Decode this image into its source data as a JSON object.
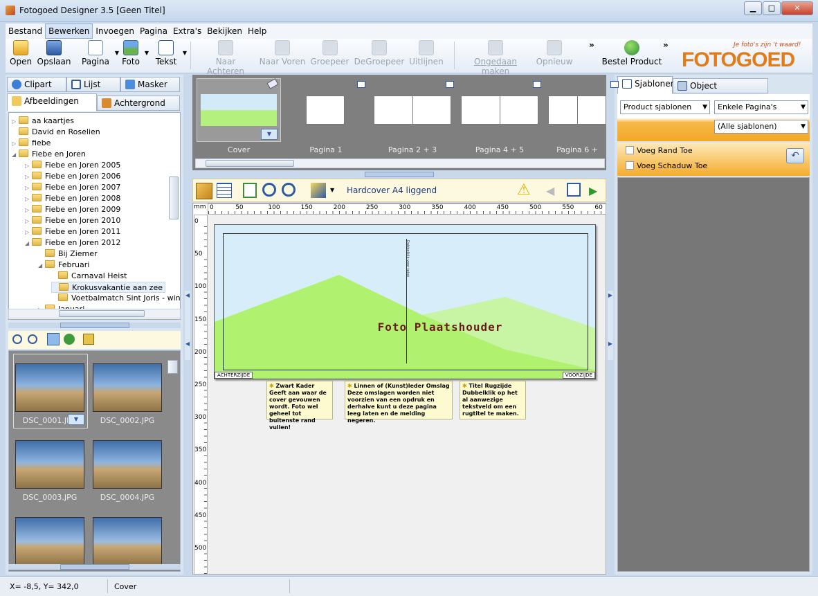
{
  "window": {
    "title": "Fotogoed Designer 3.5 [Geen Titel]",
    "min": "▁",
    "max": "□",
    "close": "✕"
  },
  "menu": [
    "Bestand",
    "Bewerken",
    "Invoegen",
    "Pagina",
    "Extra's",
    "Bekijken",
    "Help"
  ],
  "toolbar": {
    "open": "Open",
    "save": "Opslaan",
    "page": "Pagina",
    "photo": "Foto",
    "text": "Tekst",
    "send_back": "Naar Achteren",
    "bring_front": "Naar Voren",
    "group": "Groepeer",
    "ungroup": "DeGroepeer",
    "align": "Uitlijnen",
    "undo": "Ongedaan maken",
    "redo": "Opnieuw",
    "order": "Bestel Product",
    "overflow": "»"
  },
  "logo": {
    "text": "FOTOGOED",
    "slogan": "Je foto's zijn 't waard!",
    "color": "#e37b18"
  },
  "left_tabs": {
    "clipart": "Clipart",
    "list": "Lijst",
    "mask": "Masker",
    "images": "Afbeeldingen",
    "background": "Achtergrond"
  },
  "tree": [
    {
      "label": "aa kaartjes",
      "level": 0,
      "exp": "▷"
    },
    {
      "label": "David en Roselien",
      "level": 0,
      "exp": ""
    },
    {
      "label": "fiebe",
      "level": 0,
      "exp": "▷"
    },
    {
      "label": "Fiebe en Joren",
      "level": 0,
      "exp": "◢"
    },
    {
      "label": "Fiebe en Joren 2005",
      "level": 1,
      "exp": "▷"
    },
    {
      "label": "Fiebe en Joren 2006",
      "level": 1,
      "exp": "▷"
    },
    {
      "label": "Fiebe en Joren 2007",
      "level": 1,
      "exp": "▷"
    },
    {
      "label": "Fiebe en Joren 2008",
      "level": 1,
      "exp": "▷"
    },
    {
      "label": "Fiebe en Joren 2009",
      "level": 1,
      "exp": "▷"
    },
    {
      "label": "Fiebe en Joren 2010",
      "level": 1,
      "exp": "▷"
    },
    {
      "label": "Fiebe en Joren 2011",
      "level": 1,
      "exp": "▷"
    },
    {
      "label": "Fiebe en Joren 2012",
      "level": 1,
      "exp": "◢"
    },
    {
      "label": "Bij Ziemer",
      "level": 2,
      "exp": ""
    },
    {
      "label": "Februari",
      "level": 2,
      "exp": "◢"
    },
    {
      "label": "Carnaval Heist",
      "level": 3,
      "exp": ""
    },
    {
      "label": "Krokusvakantie aan zee",
      "level": 3,
      "exp": "",
      "selected": true
    },
    {
      "label": "Voetbalmatch Sint Joris - win",
      "level": 3,
      "exp": ""
    },
    {
      "label": "Januari",
      "level": 2,
      "exp": "▷"
    }
  ],
  "thumbnails": [
    "DSC_0001.JPG",
    "DSC_0002.JPG",
    "DSC_0003.JPG",
    "DSC_0004.JPG",
    "",
    ""
  ],
  "pages": [
    "Cover",
    "Pagina 1",
    "Pagina 2 + 3",
    "Pagina 4 + 5",
    "Pagina 6 +"
  ],
  "editor": {
    "product_label": "Hardcover A4 liggend",
    "ruler_unit": "mm",
    "hticks": [
      "0",
      "50",
      "100",
      "150",
      "200",
      "250",
      "300",
      "350",
      "400",
      "450",
      "500",
      "550",
      "60"
    ],
    "vticks": [
      "0",
      "50",
      "100",
      "150",
      "200",
      "250",
      "300",
      "350",
      "400",
      "450",
      "500"
    ],
    "placeholder": "Foto Plaatshouder",
    "back": "ACHTERZIJDE",
    "front": "VOORZIJDE",
    "spine_text": "Dubbelklik voor tekst"
  },
  "notes": [
    {
      "title": "Zwart Kader",
      "body": "Geeft aan waar de cover gevouwen wordt. Foto wel geheel tot buitenste rand vullen!"
    },
    {
      "title": "Linnen of (Kunst)leder Omslag",
      "body": "Deze omslagen worden niet voorzien van een opdruk en derhalve kunt u deze pagina leeg laten en de melding negeren."
    },
    {
      "title": "Titel Rugzijde",
      "body": "Dubbelklik op het al aanwezige tekstveld om een rugtitel te maken."
    }
  ],
  "right_tabs": {
    "templates": "Sjablonen",
    "props": "Object eigenschappen"
  },
  "templates": {
    "product": "Product sjablonen",
    "pages": "Enkele Pagina's",
    "filter": "(Alle sjablonen)",
    "border": "Voeg Rand Toe",
    "shadow": "Voeg Schaduw Toe"
  },
  "status": {
    "coords": "X=  -8,5, Y= 342,0",
    "page": "Cover"
  }
}
